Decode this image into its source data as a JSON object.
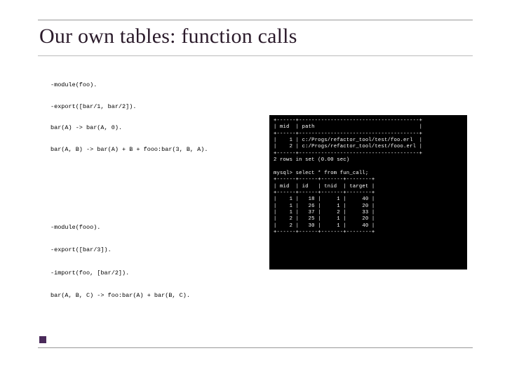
{
  "title": "Our own tables: function calls",
  "code_top": "-module(foo).\n\n-export([bar/1, bar/2]).\n\nbar(A) -> bar(A, 0).\n\nbar(A, B) -> bar(A) + B + fooo:bar(3, B, A).",
  "code_bottom": "-module(fooo).\n\n-export([bar/3]).\n\n-import(foo, [bar/2]).\n\nbar(A, B, C) -> foo:bar(A) + bar(B, C).",
  "terminal": "+------+--------------------------------------+\n| mid  | path                                 |\n+------+--------------------------------------+\n|    1 | c:/Progs/refactor_tool/test/foo.erl  |\n|    2 | c:/Progs/refactor_tool/test/fooo.erl |\n+------+--------------------------------------+\n2 rows in set (0.00 sec)\n\nmysql> select * from fun_call;\n+------+------+-------+--------+\n| mid  | id   | tnid  | target |\n+------+------+-------+--------+\n|    1 |   18 |     1 |     40 |\n|    1 |   26 |     1 |     20 |\n|    1 |   37 |     2 |     33 |\n|    2 |   25 |     1 |     20 |\n|    2 |   30 |     1 |     40 |\n+------+------+-------+--------+"
}
